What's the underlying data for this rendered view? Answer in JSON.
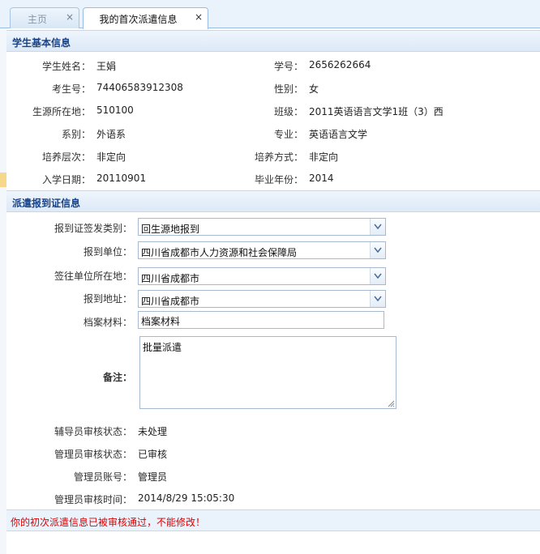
{
  "tabs": [
    {
      "label": "主页",
      "close": "×"
    },
    {
      "label": "我的首次派遣信息",
      "close": "×"
    }
  ],
  "basic": {
    "title": "学生基本信息",
    "rows": [
      {
        "l_label": "学生姓名：",
        "l_value": "王娟",
        "r_label": "学号：",
        "r_value": "2656262664"
      },
      {
        "l_label": "考生号：",
        "l_value": "74406583912308",
        "r_label": "性别：",
        "r_value": "女"
      },
      {
        "l_label": "生源所在地：",
        "l_value": "510100",
        "r_label": "班级：",
        "r_value": "2011英语语言文学1班（3）西"
      },
      {
        "l_label": "系别：",
        "l_value": "外语系",
        "r_label": "专业：",
        "r_value": "英语语言文学"
      },
      {
        "l_label": "培养层次：",
        "l_value": "非定向",
        "r_label": "培养方式：",
        "r_value": "非定向"
      },
      {
        "l_label": "入学日期：",
        "l_value": "20110901",
        "r_label": "毕业年份：",
        "r_value": "2014"
      }
    ]
  },
  "dispatch": {
    "title": "派遣报到证信息",
    "cert_type": {
      "label": "报到证签发类别：",
      "value": "回生源地报到"
    },
    "report_unit": {
      "label": "报到单位：",
      "value": "四川省成都市人力资源和社会保障局"
    },
    "unit_location": {
      "label": "签往单位所在地：",
      "value": "四川省成都市"
    },
    "report_address": {
      "label": "报到地址：",
      "value": "四川省成都市"
    },
    "archive": {
      "label": "档案材料：",
      "value": "档案材料"
    },
    "remark": {
      "label": "备注：",
      "value": "批量派遣"
    },
    "counselor_status": {
      "label": "辅导员审核状态：",
      "value": "未处理"
    },
    "admin_status": {
      "label": "管理员审核状态：",
      "value": "已审核"
    },
    "admin_account": {
      "label": "管理员账号：",
      "value": "管理员"
    },
    "admin_time": {
      "label": "管理员审核时间：",
      "value": "2014/8/29 15:05:30"
    }
  },
  "footer": {
    "message": "你的初次派遣信息已被审核通过，不能修改！"
  },
  "colors": {
    "accent": "#15428b",
    "warning": "#e00000",
    "header_bg": "#dde9f7"
  }
}
